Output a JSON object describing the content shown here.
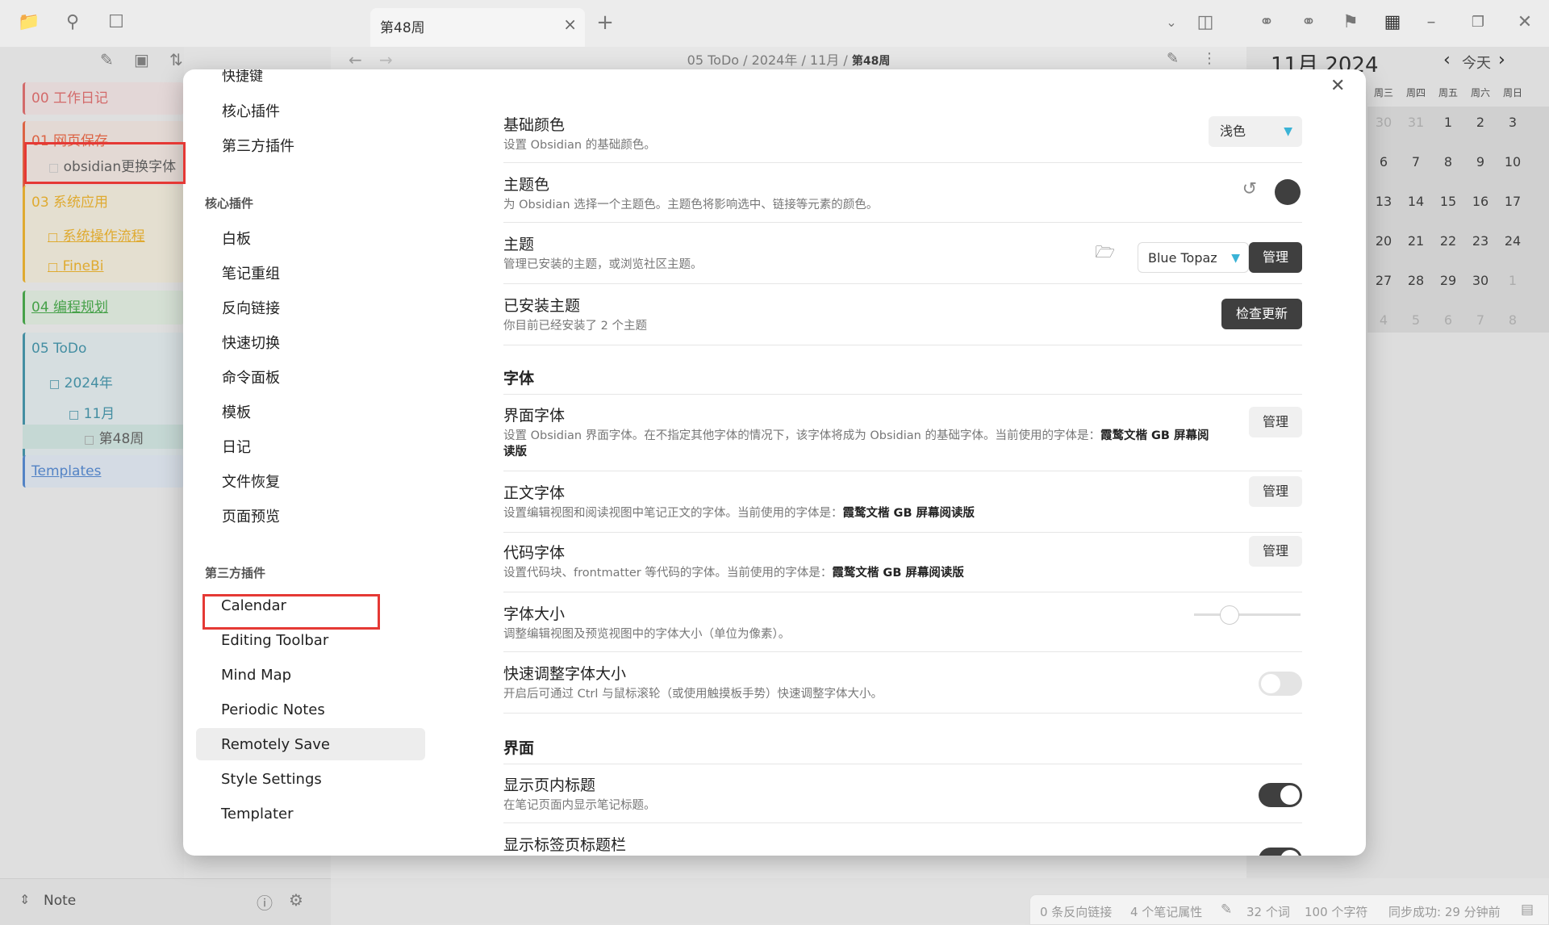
{
  "tab": {
    "title": "第48周",
    "close": "×",
    "new": "+"
  },
  "breadcrumb": {
    "parts": [
      "05 ToDo",
      "2024年",
      "11月"
    ],
    "current": "第48周",
    "sep": " / "
  },
  "sidebar": {
    "folders": [
      {
        "label": "00 工作日记",
        "color": "#e57373"
      },
      {
        "label": "01 网页保存",
        "color": "#ef6c4a"
      },
      {
        "label": "03 系统应用",
        "color": "#f2b935"
      },
      {
        "label": "04 编程规划",
        "color": "#4caf50"
      },
      {
        "label": "05 ToDo",
        "color": "#4a9bb0"
      },
      {
        "label": "Templates",
        "color": "#5b8fd6"
      }
    ],
    "file_obsidian": "obsidian更换字体",
    "sub_system": "系统操作流程",
    "sub_finebi": "FineBi",
    "todo_year": "2024年",
    "todo_month": "11月",
    "todo_week": "第48周",
    "footer_label": "Note"
  },
  "calendar": {
    "title": "11月 2024",
    "today": "今天",
    "weekdays": [
      "周三",
      "周四",
      "周五",
      "周六",
      "周日"
    ],
    "weeks": [
      [
        "30",
        "31",
        "1",
        "2",
        "3"
      ],
      [
        "6",
        "7",
        "8",
        "9",
        "10"
      ],
      [
        "13",
        "14",
        "15",
        "16",
        "17"
      ],
      [
        "20",
        "21",
        "22",
        "23",
        "24"
      ],
      [
        "27",
        "28",
        "29",
        "30",
        "1"
      ],
      [
        "4",
        "5",
        "6",
        "7",
        "8"
      ]
    ]
  },
  "status": {
    "backlinks": "0 条反向链接",
    "props": "4 个笔记属性",
    "words": "32 个词",
    "chars": "100 个字符",
    "sync": "同步成功: 29 分钟前"
  },
  "settings_nav": {
    "top_items": [
      "快捷键",
      "核心插件",
      "第三方插件"
    ],
    "core_head": "核心插件",
    "core_items": [
      "白板",
      "笔记重组",
      "反向链接",
      "快速切换",
      "命令面板",
      "模板",
      "日记",
      "文件恢复",
      "页面预览"
    ],
    "third_head": "第三方插件",
    "third_items": [
      "Calendar",
      "Editing Toolbar",
      "Mind Map",
      "Periodic Notes",
      "Remotely Save",
      "Style Settings",
      "Templater"
    ]
  },
  "settings": {
    "base_color": {
      "title": "基础颜色",
      "desc": "设置 Obsidian 的基础颜色。",
      "value": "浅色"
    },
    "accent": {
      "title": "主题色",
      "desc": "为 Obsidian 选择一个主题色。主题色将影响选中、链接等元素的颜色。",
      "color": "#3f3f3f"
    },
    "theme": {
      "title": "主题",
      "desc": "管理已安装的主题，或浏览社区主题。",
      "value": "Blue Topaz",
      "manage": "管理"
    },
    "installed": {
      "title": "已安装主题",
      "desc": "你目前已经安装了 2 个主题",
      "button": "检查更新"
    },
    "font_section": "字体",
    "ui_font": {
      "title": "界面字体",
      "desc_prefix": "设置 Obsidian 界面字体。在不指定其他字体的情况下，该字体将成为 Obsidian 的基础字体。当前使用的字体是：",
      "font": "霞鹜文楷 GB 屏幕阅读版",
      "button": "管理"
    },
    "text_font": {
      "title": "正文字体",
      "desc_prefix": "设置编辑视图和阅读视图中笔记正文的字体。当前使用的字体是：",
      "font": "霞鹜文楷 GB 屏幕阅读版",
      "button": "管理"
    },
    "code_font": {
      "title": "代码字体",
      "desc_prefix": "设置代码块、frontmatter 等代码的字体。当前使用的字体是：",
      "font": "霞鹜文楷 GB 屏幕阅读版",
      "button": "管理"
    },
    "font_size": {
      "title": "字体大小",
      "desc": "调整编辑视图及预览视图中的字体大小（单位为像素）。",
      "level": 0.33
    },
    "quick_font": {
      "title": "快速调整字体大小",
      "desc": "开启后可通过 Ctrl 与鼠标滚轮（或使用触摸板手势）快速调整字体大小。",
      "on": false
    },
    "ui_section": "界面",
    "inline_title": {
      "title": "显示页内标题",
      "desc": "在笔记页面内显示笔记标题。",
      "on": true
    },
    "tab_title_bar": {
      "title": "显示标签页标题栏",
      "on": true
    }
  }
}
